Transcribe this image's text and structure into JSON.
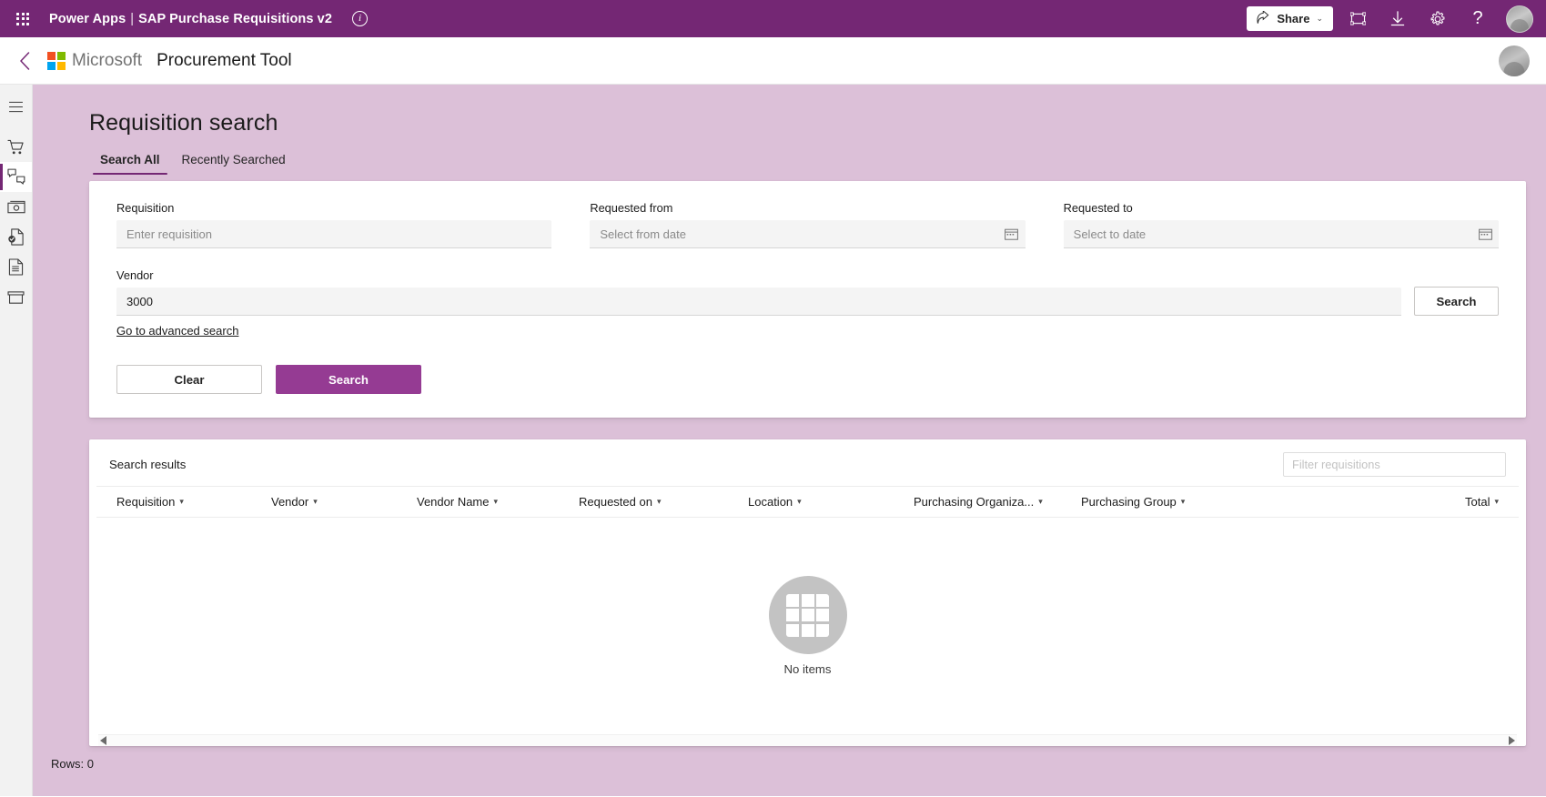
{
  "topbar": {
    "waffle_icon": "waffle-grid-icon",
    "product": "Power Apps",
    "separator": "|",
    "app_name": "SAP Purchase Requisitions v2",
    "info_icon": "info-icon",
    "info_glyph": "i",
    "share_label": "Share",
    "share_icon": "share-icon",
    "chevron": "⌄",
    "icons": [
      {
        "name": "fit-to-screen-icon"
      },
      {
        "name": "download-icon"
      },
      {
        "name": "settings-gear-icon"
      },
      {
        "name": "help-question-icon",
        "glyph": "?"
      }
    ],
    "avatar": "user-avatar"
  },
  "brandbar": {
    "back_icon": "back-chevron-icon",
    "logo": "microsoft-logo-icon",
    "microsoft": "Microsoft",
    "tool_name": "Procurement Tool",
    "avatar": "user-avatar"
  },
  "rail": {
    "items": [
      {
        "name": "hamburger-menu-icon",
        "label": "Menu"
      },
      {
        "name": "shopping-cart-icon",
        "label": "Cart"
      },
      {
        "name": "approvals-icon",
        "label": "Approvals",
        "active": true
      },
      {
        "name": "money-invoice-icon",
        "label": "Invoices"
      },
      {
        "name": "document-approved-icon",
        "label": "Approved documents"
      },
      {
        "name": "document-lines-icon",
        "label": "Documents"
      },
      {
        "name": "archive-tray-icon",
        "label": "Archive"
      }
    ]
  },
  "page": {
    "title": "Requisition search",
    "tabs": [
      {
        "label": "Search All",
        "selected": true
      },
      {
        "label": "Recently Searched",
        "selected": false
      }
    ]
  },
  "search_form": {
    "requisition": {
      "label": "Requisition",
      "placeholder": "Enter requisition",
      "value": ""
    },
    "requested_from": {
      "label": "Requested from",
      "placeholder": "Select from date",
      "value": "",
      "calendar_icon": "calendar-icon"
    },
    "requested_to": {
      "label": "Requested to",
      "placeholder": "Select to date",
      "value": "",
      "calendar_icon": "calendar-icon"
    },
    "vendor": {
      "label": "Vendor",
      "placeholder": "",
      "value": "3000"
    },
    "vendor_search_label": "Search",
    "advanced_link": "Go to advanced search",
    "clear_label": "Clear",
    "search_label": "Search"
  },
  "results": {
    "title": "Search results",
    "filter_placeholder": "Filter requisitions",
    "filter_value": "",
    "columns": [
      {
        "label": "Requisition"
      },
      {
        "label": "Vendor"
      },
      {
        "label": "Vendor Name"
      },
      {
        "label": "Requested on"
      },
      {
        "label": "Location"
      },
      {
        "label": "Purchasing Organiza..."
      },
      {
        "label": "Purchasing Group"
      },
      {
        "label": "Total"
      }
    ],
    "empty_label": "No items",
    "empty_icon": "empty-grid-icon",
    "rows_count": "Rows: 0"
  },
  "colors": {
    "header_purple": "#742774",
    "accent_purple": "#953b93",
    "page_background": "#dcc0d8"
  }
}
